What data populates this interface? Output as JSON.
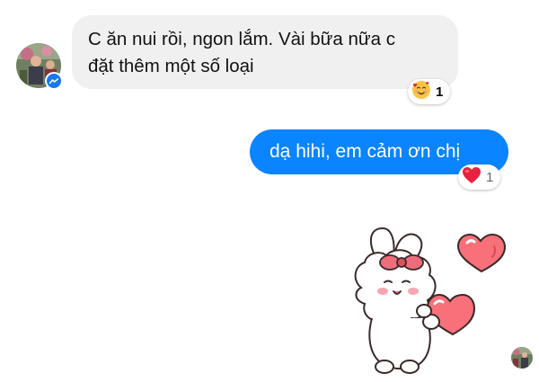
{
  "conversation": {
    "incoming": {
      "line1": "C ăn nui rồi, ngon lắm. Vài bữa nữa c",
      "line2": "đặt thêm một số loại",
      "reaction": {
        "emoji_icon": "smiling-face-with-hearts-icon",
        "count": "1"
      }
    },
    "outgoing": {
      "text": "dạ hihi, em cảm ơn chị",
      "reaction": {
        "emoji_icon": "red-heart-icon",
        "count": "1"
      }
    },
    "sticker": {
      "icon": "bunny-holding-heart-sticker"
    },
    "colors": {
      "incoming_bubble": "#f0f0f0",
      "outgoing_bubble": "#0a84ff",
      "messenger_badge": "#1877f2",
      "heart": "#e8213f"
    }
  }
}
